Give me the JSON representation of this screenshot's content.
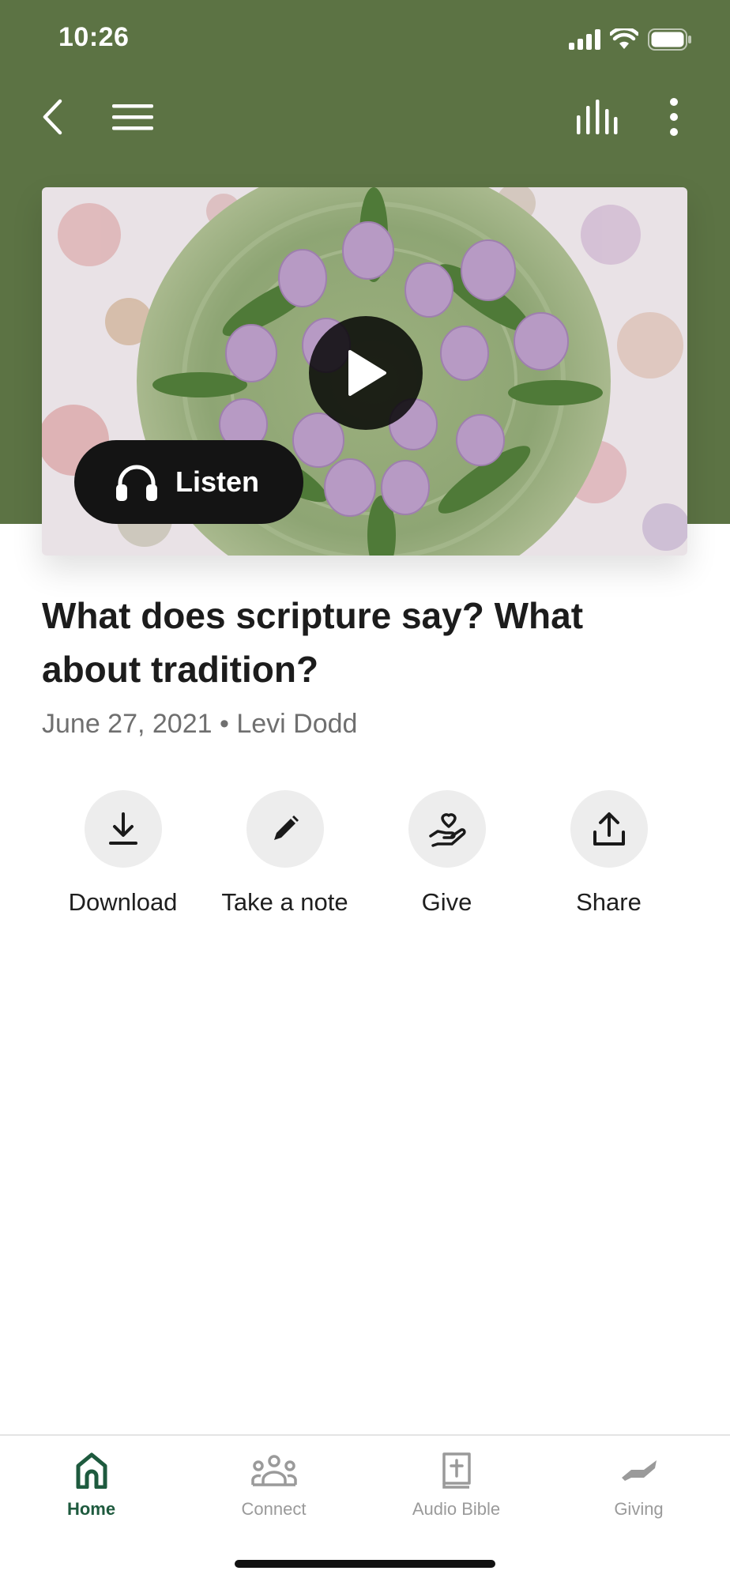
{
  "status_bar": {
    "time": "10:26"
  },
  "colors": {
    "header_bg": "#5c7344",
    "active_tab": "#1e5a3e",
    "inactive_tab": "#9a9a9a"
  },
  "top_nav": {
    "icons": [
      "back-chevron-icon",
      "hamburger-menu-icon",
      "audio-levels-icon",
      "more-vertical-icon"
    ]
  },
  "hero": {
    "image": "purple tulips bouquet on green plate",
    "listen_label": "Listen"
  },
  "sermon": {
    "title": "What does scripture say? What about tradition?",
    "date": "June 27, 2021",
    "separator": "•",
    "speaker": "Levi Dodd"
  },
  "actions": [
    {
      "label": "Download",
      "icon": "download-icon"
    },
    {
      "label": "Take a note",
      "icon": "pencil-icon"
    },
    {
      "label": "Give",
      "icon": "give-hand-heart-icon"
    },
    {
      "label": "Share",
      "icon": "share-upload-icon"
    }
  ],
  "tabs": [
    {
      "label": "Home",
      "icon": "home-icon",
      "active": true
    },
    {
      "label": "Connect",
      "icon": "people-group-icon",
      "active": false
    },
    {
      "label": "Audio Bible",
      "icon": "bible-icon",
      "active": false
    },
    {
      "label": "Giving",
      "icon": "giving-hand-icon",
      "active": false
    }
  ]
}
